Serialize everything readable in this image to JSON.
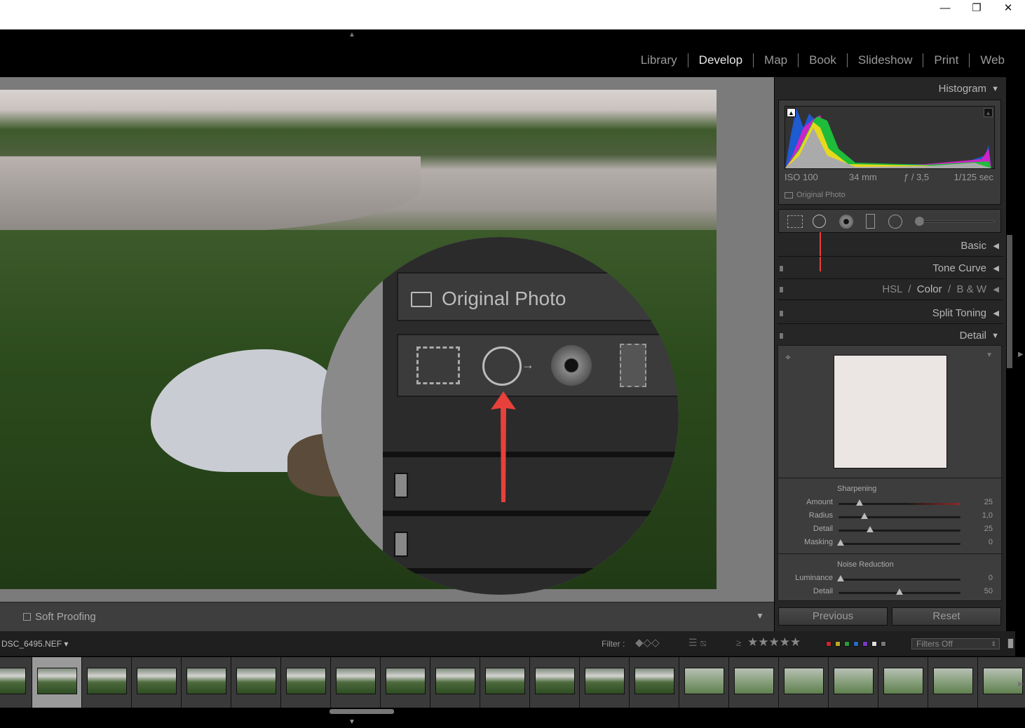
{
  "window": {
    "minimize": "—",
    "restore": "❐",
    "close": "✕"
  },
  "modules": [
    {
      "label": "Library"
    },
    {
      "label": "Develop",
      "active": true
    },
    {
      "label": "Map"
    },
    {
      "label": "Book"
    },
    {
      "label": "Slideshow"
    },
    {
      "label": "Print"
    },
    {
      "label": "Web"
    }
  ],
  "histogram": {
    "title": "Histogram",
    "iso": "ISO 100",
    "focal": "34 mm",
    "aperture": "ƒ / 3,5",
    "shutter": "1/125 sec",
    "original_photo": "Original Photo"
  },
  "magnifier": {
    "original_photo": "Original Photo"
  },
  "panels": {
    "basic": "Basic",
    "tone_curve": "Tone Curve",
    "hsl": "HSL",
    "color": "Color",
    "bw": "B & W",
    "split_toning": "Split Toning",
    "detail": "Detail"
  },
  "detail": {
    "sharpening": "Sharpening",
    "sharpening_sliders": [
      {
        "label": "Amount",
        "value": "25",
        "pos": 0.17
      },
      {
        "label": "Radius",
        "value": "1,0",
        "pos": 0.21
      },
      {
        "label": "Detail",
        "value": "25",
        "pos": 0.26
      },
      {
        "label": "Masking",
        "value": "0",
        "pos": 0.02
      }
    ],
    "noise_reduction": "Noise Reduction",
    "noise_sliders": [
      {
        "label": "Luminance",
        "value": "0",
        "pos": 0.02
      },
      {
        "label": "Detail",
        "value": "50",
        "pos": 0.5
      }
    ]
  },
  "buttons": {
    "previous": "Previous",
    "reset": "Reset"
  },
  "toolbar": {
    "soft_proofing": "Soft Proofing"
  },
  "filmstrip": {
    "filename": "DSC_6495.NEF ▾",
    "filter_label": "Filter :",
    "filters_off": "Filters Off",
    "stars": "★★★★★",
    "gte": "≥",
    "label_colors": [
      "#c0282b",
      "#b8a82a",
      "#2a9a3a",
      "#2a6ac0",
      "#7a3ac0",
      "#dddddd",
      "#777777"
    ]
  },
  "accent": {
    "arrow": "#e8403a"
  }
}
